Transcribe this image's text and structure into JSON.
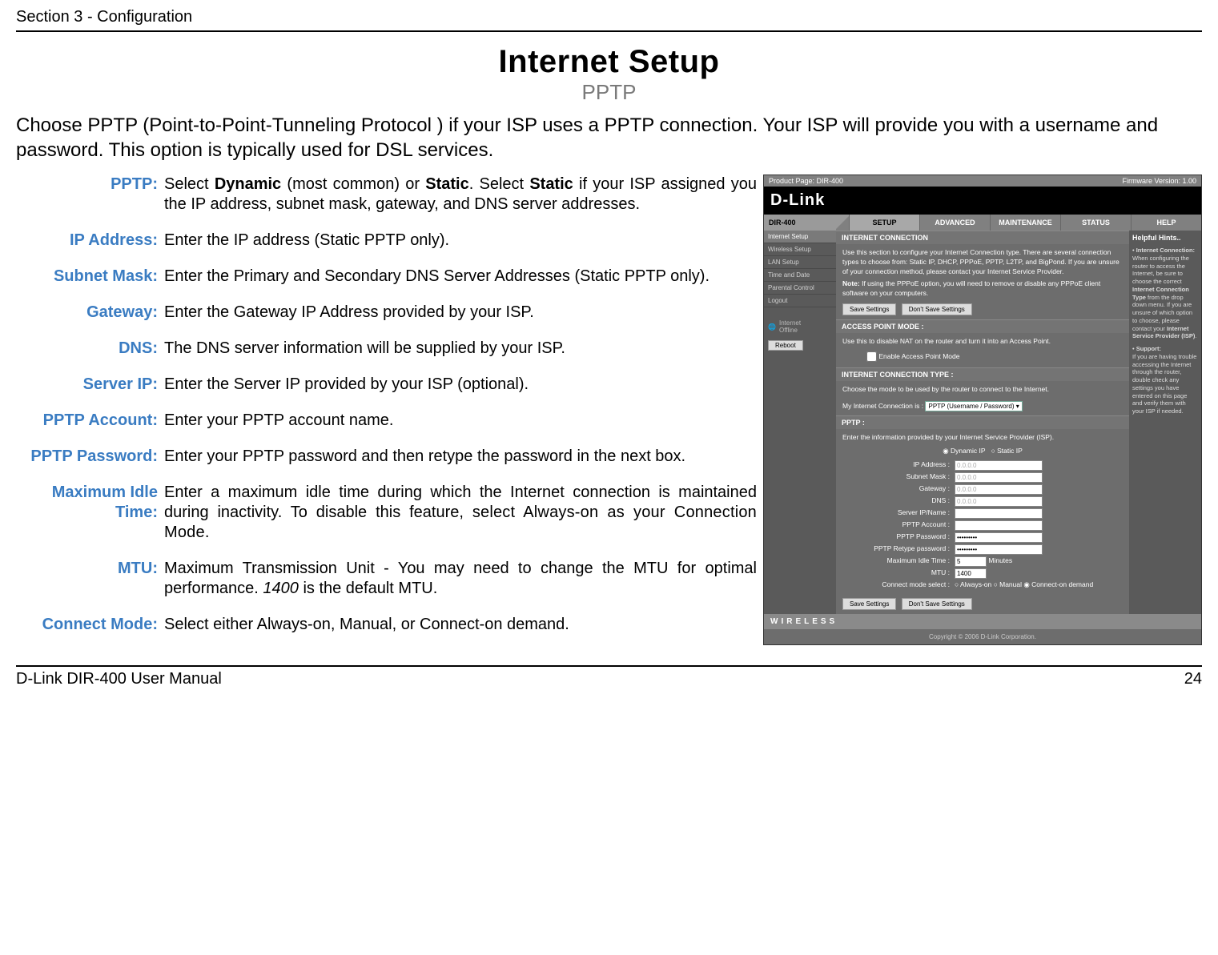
{
  "header": "Section 3 - Configuration",
  "title": "Internet Setup",
  "subtitle": "PPTP",
  "intro": "Choose PPTP (Point-to-Point-Tunneling Protocol ) if your ISP uses a PPTP connection. Your ISP will provide you with a username and password. This option is typically used for DSL services.",
  "defs": {
    "pptp": {
      "label": "PPTP:",
      "text_pre": "Select ",
      "bold1": "Dynamic",
      "mid1": " (most common) or ",
      "bold2": "Static",
      "mid2": ". Select ",
      "bold3": "Static",
      "text_post": " if your ISP assigned you the IP address, subnet mask, gateway, and DNS server addresses."
    },
    "ip": {
      "label": "IP Address:",
      "text": "Enter the IP address (Static PPTP only)."
    },
    "subnet": {
      "label": "Subnet Mask:",
      "text": "Enter the Primary and Secondary DNS Server Addresses (Static PPTP only)."
    },
    "gateway": {
      "label": "Gateway:",
      "text": "Enter the Gateway IP Address provided by your ISP."
    },
    "dns": {
      "label": "DNS:",
      "text": "The DNS server information will be supplied by your ISP."
    },
    "serverip": {
      "label": "Server IP:",
      "text": "Enter the Server IP provided by your ISP (optional)."
    },
    "account": {
      "label": "PPTP Account:",
      "text": "Enter your PPTP account name."
    },
    "password": {
      "label": "PPTP Password:",
      "text": "Enter your PPTP password and then retype the password in the next box."
    },
    "idle": {
      "label": "Maximum Idle Time:",
      "text_pre": "Enter a maximum idle time during which the Internet connection is maintained during inactivity. To disable this feature, ",
      "text_span": "select Always-on as your Connection Mode."
    },
    "mtu": {
      "label": "MTU:",
      "text_pre": "Maximum Transmission Unit - You may need to change the MTU for optimal performance. ",
      "text_italic": "1400",
      "text_post": " is the default MTU."
    },
    "connect": {
      "label": "Connect Mode:",
      "text": "Select either Always-on, Manual, or Connect-on demand."
    }
  },
  "router": {
    "top_left": "Product Page: DIR-400",
    "top_right": "Firmware Version: 1.00",
    "logo": "D-Link",
    "model": "DIR-400",
    "tabs": [
      "SETUP",
      "ADVANCED",
      "MAINTENANCE",
      "STATUS",
      "HELP"
    ],
    "sidebar": [
      "Internet Setup",
      "Wireless Setup",
      "LAN Setup",
      "Time and Date",
      "Parental Control",
      "Logout"
    ],
    "internet_status_label": "Internet",
    "internet_status_value": "Offline",
    "reboot": "Reboot",
    "sec_ic_title": "INTERNET CONNECTION",
    "sec_ic_text1": "Use this section to configure your Internet Connection type. There are several connection types to choose from: Static IP, DHCP, PPPoE, PPTP, L2TP, and BigPond. If you are unsure of your connection method, please contact your Internet Service Provider.",
    "sec_ic_note_label": "Note:",
    "sec_ic_note": " If using the PPPoE option, you will need to remove or disable any PPPoE client software on your computers.",
    "btn_save": "Save Settings",
    "btn_dont": "Don't Save Settings",
    "sec_ap_title": "ACCESS POINT MODE :",
    "sec_ap_text": "Use this to disable NAT on the router and turn it into an Access Point.",
    "sec_ap_check": "Enable Access Point Mode",
    "sec_ict_title": "INTERNET CONNECTION TYPE :",
    "sec_ict_text": "Choose the mode to be used by the router to connect to the Internet.",
    "sec_ict_label": "My Internet Connection is :",
    "sec_ict_select": "PPTP (Username / Password)",
    "sec_pptp_title": "PPTP :",
    "sec_pptp_text": "Enter the information provided by your Internet Service Provider (ISP).",
    "radio_dynamic": "Dynamic IP",
    "radio_static": "Static IP",
    "fields": {
      "ip": {
        "label": "IP Address :",
        "val": "0.0.0.0"
      },
      "subnet": {
        "label": "Subnet Mask :",
        "val": "0.0.0.0"
      },
      "gateway": {
        "label": "Gateway :",
        "val": "0.0.0.0"
      },
      "dns": {
        "label": "DNS :",
        "val": "0.0.0.0"
      },
      "server": {
        "label": "Server IP/Name :",
        "val": ""
      },
      "account": {
        "label": "PPTP Account :",
        "val": ""
      },
      "password": {
        "label": "PPTP Password :",
        "val": "•••••••••"
      },
      "retype": {
        "label": "PPTP Retype password :",
        "val": "•••••••••"
      },
      "idle": {
        "label": "Maximum Idle Time :",
        "val": "5",
        "unit": "Minutes"
      },
      "mtu": {
        "label": "MTU :",
        "val": "1400"
      },
      "connect": {
        "label": "Connect mode select :",
        "opt1": "Always-on",
        "opt2": "Manual",
        "opt3": "Connect-on demand"
      }
    },
    "right_title": "Helpful Hints..",
    "right_h1": "Internet Connection:",
    "right_t1": "When configuring the router to access the Internet, be sure to choose the correct ",
    "right_t1b": "Internet Connection Type",
    "right_t1c": " from the drop down menu. If you are unsure of which option to choose, please contact your ",
    "right_t1d": "Internet Service Provider (ISP)",
    "right_h2": "Support:",
    "right_t2": "If you are having trouble accessing the Internet through the router, double check any settings you have entered on this page and verify them with your ISP if needed.",
    "wireless": "WIRELESS",
    "copyright": "Copyright © 2006 D-Link Corporation."
  },
  "footer": {
    "left": "D-Link DIR-400 User Manual",
    "right": "24"
  }
}
